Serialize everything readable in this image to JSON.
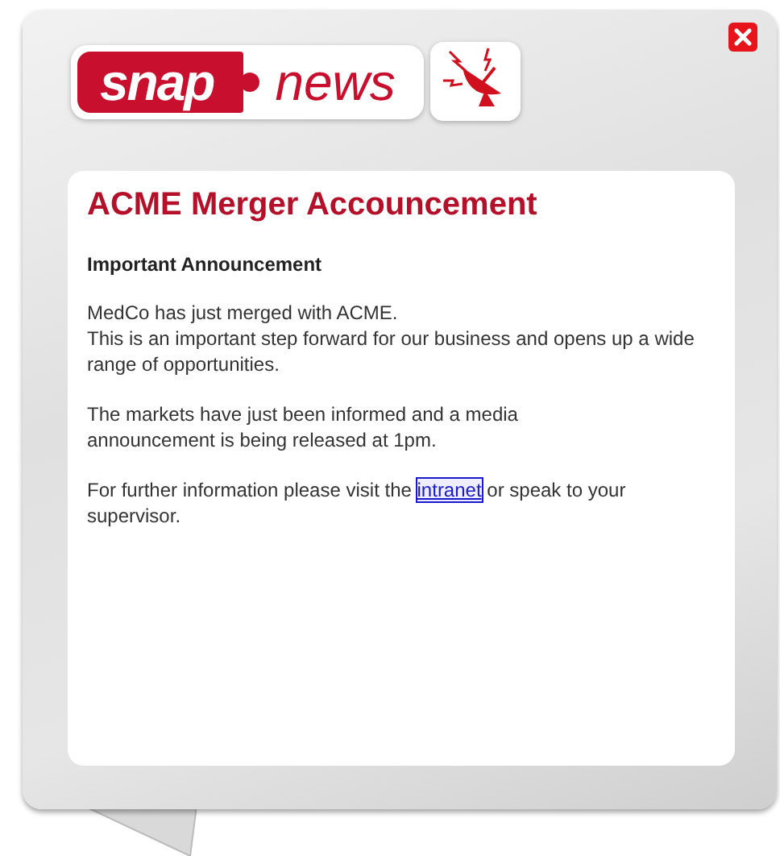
{
  "logo": {
    "word_1": "snap",
    "word_2": "news"
  },
  "article": {
    "title": "ACME Merger Accouncement",
    "subtitle": "Important Announcement",
    "paragraphs": [
      "MedCo has just merged with ACME.\nThis is an important step forward for our business and opens up a wide range of opportunities.",
      "The markets have just been informed and a media\nannouncement is being released at 1pm."
    ],
    "closing": {
      "text_before": "For further information please visit the",
      "link": "intranet",
      "link_focused": true,
      "text_after": "or speak to your supervisor."
    }
  }
}
